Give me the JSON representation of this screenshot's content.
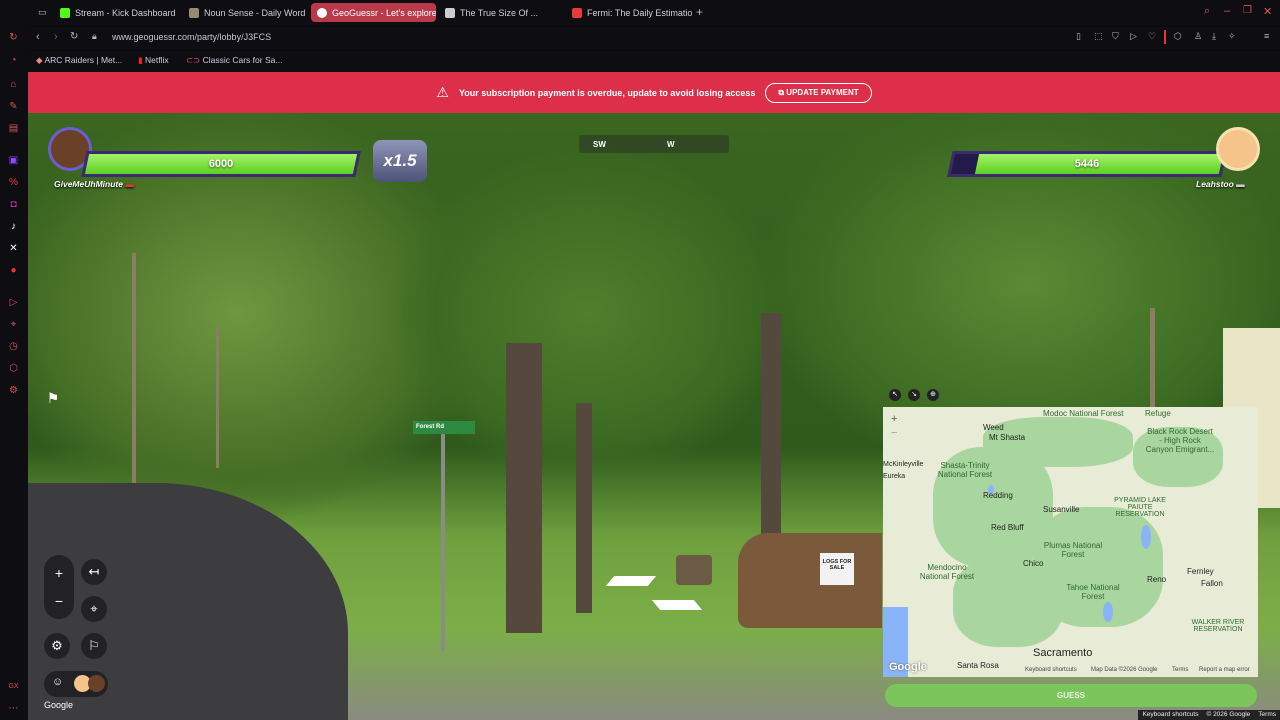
{
  "tabs": [
    {
      "label": "Stream - Kick Dashboard",
      "color": "#53fc18"
    },
    {
      "label": "Noun Sense - Daily Word",
      "color": "#9a8a70"
    },
    {
      "label": "GeoGuessr - Let's explore",
      "color": "#ffffff"
    },
    {
      "label": "The True Size Of ...",
      "color": "#cccccc"
    },
    {
      "label": "Fermi: The Daily Estimation",
      "color": "#e83a3a"
    }
  ],
  "address": {
    "url": "www.geoguessr.com/party/lobby/J3FCS"
  },
  "bookmarks": [
    "ARC Raiders | Met...",
    "Netflix",
    "Classic Cars for Sa..."
  ],
  "banner": {
    "message": "Your subscription payment is overdue, update to avoid losing access",
    "button": "UPDATE PAYMENT"
  },
  "players": {
    "left": {
      "name": "GiveMeUhMinute",
      "score": "6000",
      "health": 1.0
    },
    "right": {
      "name": "Leahstoo",
      "score": "5446",
      "health": 0.91
    }
  },
  "multiplier": "x1.5",
  "compass": {
    "labels": [
      "SW",
      "W"
    ]
  },
  "street_sign": "Forest Rd",
  "sale_sign": "LOGS FOR SALE",
  "map": {
    "cities": [
      "Weed",
      "Mt Shasta",
      "Redding",
      "Susanville",
      "Red Bluff",
      "Chico",
      "Reno",
      "Fernley",
      "Fallon",
      "Sacramento",
      "Santa Rosa",
      "McKinleyville",
      "Eureka"
    ],
    "forests": [
      "Modoc National Forest",
      "Refuge",
      "Shasta-Trinity National Forest",
      "Black Rock Desert - High Rock Canyon Emigrant...",
      "PYRAMID LAKE PAIUTE RESERVATION",
      "Mendocino National Forest",
      "Plumas National Forest",
      "Tahoe National Forest",
      "WALKER RIVER RESERVATION"
    ],
    "google": "Google",
    "footer": [
      "Keyboard shortcuts",
      "Map Data ©2026 Google",
      "Terms",
      "Report a map error"
    ]
  },
  "guess_button": "GUESS",
  "google_logo": "Google",
  "bottom_bar": [
    "Keyboard shortcuts",
    "© 2026 Google",
    "Terms"
  ]
}
